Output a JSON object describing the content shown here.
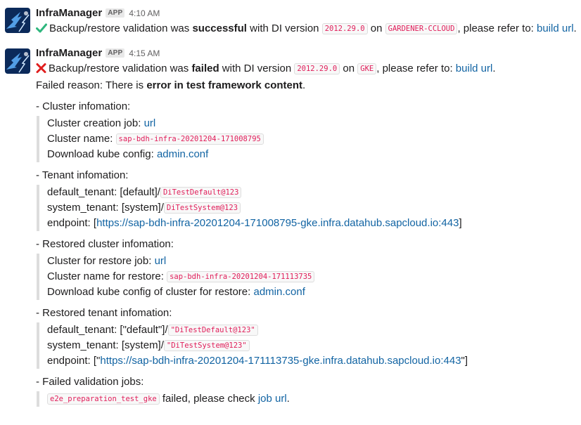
{
  "messages": [
    {
      "sender": "InfraManager",
      "badge": "APP",
      "time": "4:10 AM",
      "text_pre": "Backup/restore validation was ",
      "status_word": "successful",
      "text_mid": " with DI version ",
      "version": "2012.29.0",
      "text_on": " on ",
      "platform": "GARDENER-CCLOUD",
      "text_refer": ", please refer to: ",
      "link": "build url",
      "text_end": ".",
      "status_icon": "check-icon"
    },
    {
      "sender": "InfraManager",
      "badge": "APP",
      "time": "4:15 AM",
      "text_pre": "Backup/restore validation was ",
      "status_word": "failed",
      "text_mid": " with DI version ",
      "version": "2012.29.0",
      "text_on": " on ",
      "platform": "GKE",
      "text_refer": ", please refer to: ",
      "link": "build url",
      "text_end": ".",
      "status_icon": "x-icon",
      "reason_pre": "Failed reason: There is ",
      "reason_bold": "error in test framework content",
      "reason_end": ".",
      "cluster": {
        "title": "- Cluster infomation:",
        "job_label": "Cluster creation job: ",
        "job_link": "url",
        "name_label": "Cluster name: ",
        "name_code": "sap-bdh-infra-20201204-171008795",
        "kube_label": "Download kube config: ",
        "kube_link": "admin.conf"
      },
      "tenant": {
        "title": "- Tenant infomation:",
        "default_label": "default_tenant: [default]/",
        "default_code": "DiTestDefault@123",
        "system_label": "system_tenant: [system]/",
        "system_code": "DiTestSystem@123",
        "endpoint_label": "endpoint: [",
        "endpoint_link": "https://sap-bdh-infra-20201204-171008795-gke.infra.datahub.sapcloud.io:443",
        "endpoint_end": "]"
      },
      "restored_cluster": {
        "title": "- Restored cluster infomation:",
        "job_label": "Cluster for restore job: ",
        "job_link": "url",
        "name_label": "Cluster name for restore: ",
        "name_code": "sap-bdh-infra-20201204-171113735",
        "kube_label": "Download kube config of cluster for restore: ",
        "kube_link": "admin.conf"
      },
      "restored_tenant": {
        "title": "- Restored tenant infomation:",
        "default_label": "default_tenant: [\"default\"]/",
        "default_code": "\"DiTestDefault@123\"",
        "system_label": "system_tenant: [system]/",
        "system_code": "\"DiTestSystem@123\"",
        "endpoint_label": "endpoint: [\"",
        "endpoint_link": "https://sap-bdh-infra-20201204-171113735-gke.infra.datahub.sapcloud.io:443",
        "endpoint_end": "\"]"
      },
      "failed_jobs": {
        "title": "- Failed validation jobs:",
        "job_code": "e2e_preparation_test_gke",
        "job_text": " failed, please check ",
        "job_link": "job url",
        "job_end": "."
      }
    }
  ],
  "colors": {
    "link": "#1264a3",
    "code": "#e01e5a",
    "success": "#2eb67d",
    "failure": "#e01e1e"
  }
}
